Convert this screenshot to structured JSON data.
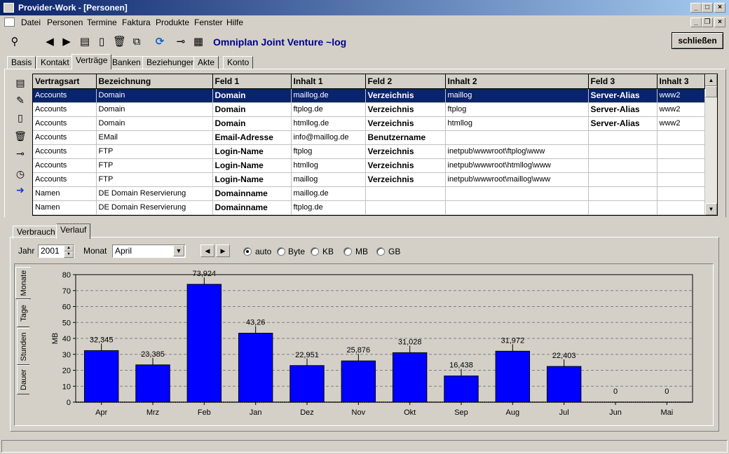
{
  "window": {
    "title": "Provider-Work - [Personen]"
  },
  "menu": [
    "Datei",
    "Personen",
    "Termine",
    "Faktura",
    "Produkte",
    "Fenster",
    "Hilfe"
  ],
  "toolbar": {
    "company": "Omniplan Joint Venture ~log",
    "close_label": "schließen"
  },
  "tabs": [
    "Basis",
    "Kontakt",
    "Verträge",
    "Banken",
    "Beziehungen",
    "Akte",
    "Konto"
  ],
  "active_tab": "Verträge",
  "grid": {
    "columns": [
      "Vertragsart",
      "Bezeichnung",
      "Feld 1",
      "Inhalt 1",
      "Feld 2",
      "Inhalt 2",
      "Feld 3",
      "Inhalt 3"
    ],
    "rows": [
      [
        "Accounts",
        "Domain",
        "Domain",
        "maillog.de",
        "Verzeichnis",
        "maillog",
        "Server-Alias",
        "www2"
      ],
      [
        "Accounts",
        "Domain",
        "Domain",
        "ftplog.de",
        "Verzeichnis",
        "ftplog",
        "Server-Alias",
        "www2"
      ],
      [
        "Accounts",
        "Domain",
        "Domain",
        "htmllog.de",
        "Verzeichnis",
        "htmllog",
        "Server-Alias",
        "www2"
      ],
      [
        "Accounts",
        "EMail",
        "Email-Adresse",
        "info@maillog.de",
        "Benutzername",
        "",
        "",
        ""
      ],
      [
        "Accounts",
        "FTP",
        "Login-Name",
        "ftplog",
        "Verzeichnis",
        "inetpub\\wwwroot\\ftplog\\www",
        "",
        ""
      ],
      [
        "Accounts",
        "FTP",
        "Login-Name",
        "htmllog",
        "Verzeichnis",
        "inetpub\\wwwroot\\htmllog\\www",
        "",
        ""
      ],
      [
        "Accounts",
        "FTP",
        "Login-Name",
        "maillog",
        "Verzeichnis",
        "inetpub\\wwwroot\\maillog\\www",
        "",
        ""
      ],
      [
        "Namen",
        "DE Domain Reservierung",
        "Domainname",
        "maillog.de",
        "",
        "",
        "",
        ""
      ],
      [
        "Namen",
        "DE Domain Reservierung",
        "Domainname",
        "ftplog.de",
        "",
        "",
        "",
        ""
      ]
    ]
  },
  "lower_tabs": [
    "Verbrauch",
    "Verlauf"
  ],
  "controls": {
    "year_label": "Jahr",
    "year_value": "2001",
    "month_label": "Monat",
    "month_value": "April",
    "units": [
      "auto",
      "Byte",
      "KB",
      "MB",
      "GB"
    ],
    "unit_selected": "auto"
  },
  "side_tabs": [
    "Monate",
    "Tage",
    "Stunden",
    "Dauer"
  ],
  "chart_data": {
    "type": "bar",
    "categories": [
      "Apr",
      "Mrz",
      "Feb",
      "Jan",
      "Dez",
      "Nov",
      "Okt",
      "Sep",
      "Aug",
      "Jul",
      "Jun",
      "Mai"
    ],
    "values": [
      32.345,
      23.385,
      73.924,
      43.26,
      22.951,
      25.876,
      31.028,
      16.438,
      31.972,
      22.403,
      0,
      0
    ],
    "labels": [
      "32,345",
      "23,385",
      "73,924",
      "43,26",
      "22,951",
      "25,876",
      "31,028",
      "16,438",
      "31,972",
      "22,403",
      "0",
      "0"
    ],
    "ylabel": "MB",
    "ylim": [
      0,
      80
    ],
    "yticks": [
      0,
      10,
      20,
      30,
      40,
      50,
      60,
      70,
      80
    ],
    "grid": true,
    "bar_color": "#0000ff"
  }
}
